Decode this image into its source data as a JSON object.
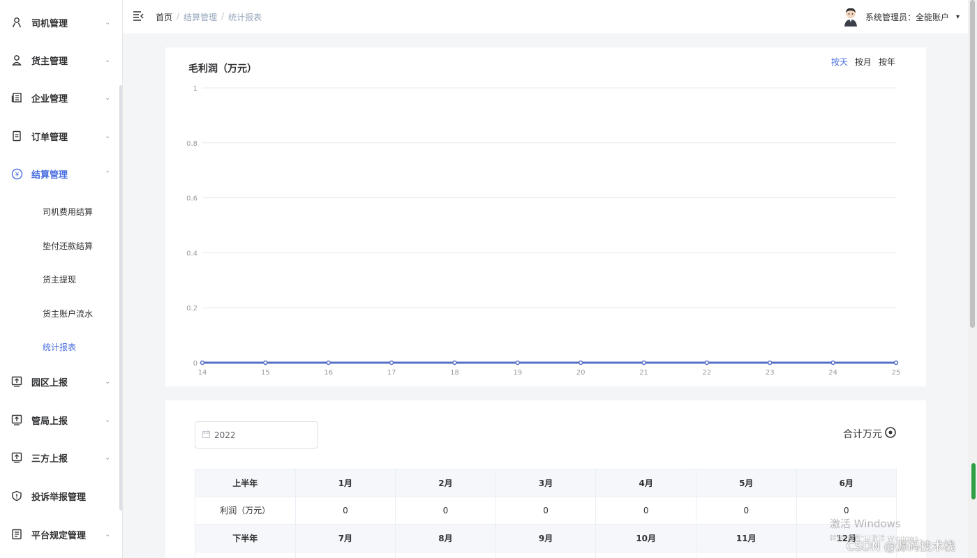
{
  "sidebar": {
    "menus": [
      {
        "label": "司机管理",
        "icon": "person-icon",
        "arrow": "⌄"
      },
      {
        "label": "货主管理",
        "icon": "user-icon",
        "arrow": "⌄"
      },
      {
        "label": "企业管理",
        "icon": "building-icon",
        "arrow": "⌄"
      },
      {
        "label": "订单管理",
        "icon": "document-icon",
        "arrow": "⌄"
      },
      {
        "label": "结算管理",
        "icon": "yen-icon",
        "arrow": "⌃"
      },
      {
        "label": "园区上报",
        "icon": "upload-icon",
        "arrow": "⌄"
      },
      {
        "label": "管局上报",
        "icon": "upload-icon",
        "arrow": "⌄"
      },
      {
        "label": "三方上报",
        "icon": "upload-icon",
        "arrow": "⌄"
      },
      {
        "label": "投诉举报管理",
        "icon": "shield-icon",
        "arrow": ""
      },
      {
        "label": "平台规定管理",
        "icon": "rules-icon",
        "arrow": "⌄"
      }
    ],
    "submenu": [
      "司机费用结算",
      "垫付还款结算",
      "货主提现",
      "货主账户流水",
      "统计报表"
    ]
  },
  "header": {
    "breadcrumb": [
      "首页",
      "结算管理",
      "统计报表"
    ],
    "separator": "/",
    "user_label": "系统管理员：全能账户",
    "dropdown": "▾"
  },
  "chart": {
    "period_options": [
      "按天",
      "按月",
      "按年"
    ],
    "selected_period": "按天"
  },
  "chart_data": {
    "type": "line",
    "title": "毛利润（万元）",
    "x": [
      "14",
      "15",
      "16",
      "17",
      "18",
      "19",
      "20",
      "21",
      "22",
      "23",
      "24",
      "25"
    ],
    "series": [
      {
        "values": [
          0,
          0,
          0,
          0,
          0,
          0,
          0,
          0,
          0,
          0,
          0,
          0
        ],
        "color": "#5470c6"
      }
    ],
    "y_ticks": [
      "0",
      "0.2",
      "0.4",
      "0.6",
      "0.8",
      "1"
    ],
    "ylim": [
      0,
      1
    ],
    "grid": true
  },
  "table_section": {
    "year": "2022",
    "total_label": "合计万元",
    "rows": [
      [
        "上半年",
        "1月",
        "2月",
        "3月",
        "4月",
        "5月",
        "6月"
      ],
      [
        "利润（万元）",
        "0",
        "0",
        "0",
        "0",
        "0",
        "0"
      ],
      [
        "下半年",
        "7月",
        "8月",
        "9月",
        "10月",
        "11月",
        "12月"
      ],
      [
        "",
        "",
        "",
        "",
        "",
        "",
        ""
      ]
    ]
  },
  "watermark": {
    "windows_line1": "激活 Windows",
    "windows_line2": "转到\"设置\"以激活 Windows。",
    "csdn": "CSDN @源码技术栈"
  },
  "colors": {
    "accent": "#4a6ee0",
    "line": "#5470c6"
  }
}
